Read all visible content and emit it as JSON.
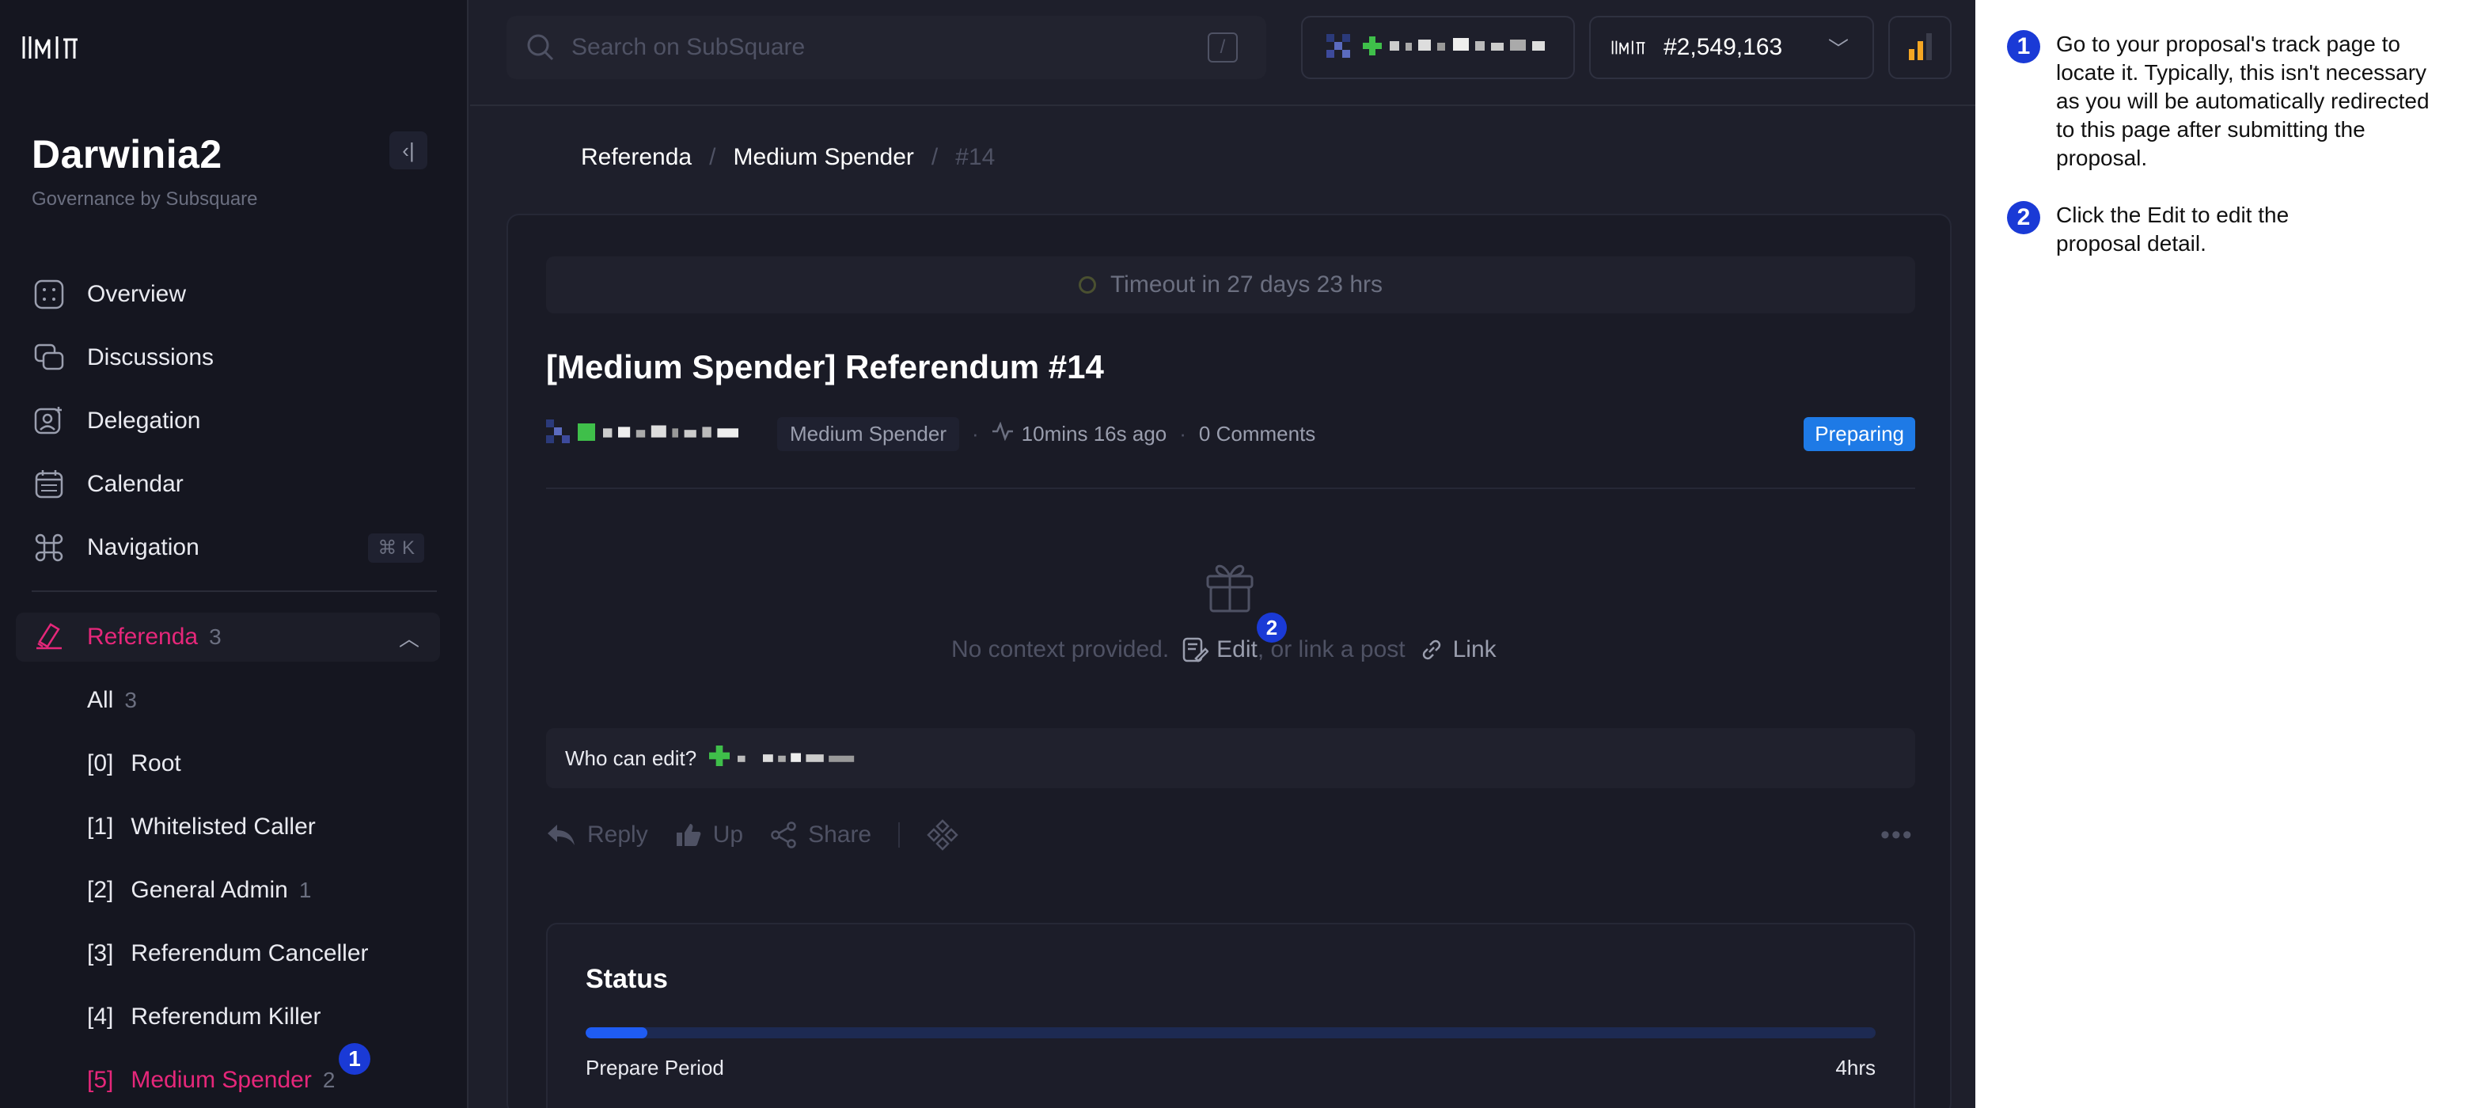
{
  "app": {
    "name": "Darwinia2",
    "subtitle": "Governance by Subsquare"
  },
  "sidebar": {
    "items": [
      {
        "label": "Overview",
        "icon": "overview-icon"
      },
      {
        "label": "Discussions",
        "icon": "discussions-icon"
      },
      {
        "label": "Delegation",
        "icon": "delegation-icon"
      },
      {
        "label": "Calendar",
        "icon": "calendar-icon"
      },
      {
        "label": "Navigation",
        "icon": "command-icon",
        "shortcut": "⌘ K"
      }
    ],
    "referenda": {
      "label": "Referenda",
      "count": "3",
      "tracks": [
        {
          "num": "All",
          "label": "",
          "count": "3"
        },
        {
          "num": "[0]",
          "label": "Root",
          "count": ""
        },
        {
          "num": "[1]",
          "label": "Whitelisted Caller",
          "count": ""
        },
        {
          "num": "[2]",
          "label": "General Admin",
          "count": "1"
        },
        {
          "num": "[3]",
          "label": "Referendum Canceller",
          "count": ""
        },
        {
          "num": "[4]",
          "label": "Referendum Killer",
          "count": ""
        },
        {
          "num": "[5]",
          "label": "Medium Spender",
          "count": "2"
        }
      ]
    }
  },
  "topbar": {
    "search_placeholder": "Search on SubSquare",
    "search_shortcut": "/",
    "block_number": "#2,549,163"
  },
  "breadcrumb": {
    "items": [
      "Referenda",
      "Medium Spender"
    ],
    "current": "#14"
  },
  "post": {
    "timeout": "Timeout in 27 days 23 hrs",
    "title": "[Medium Spender] Referendum #14",
    "track_tag": "Medium Spender",
    "time_ago": "10mins 16s ago",
    "comments": "0 Comments",
    "status": "Preparing",
    "empty_text": "No context provided.",
    "edit_label": "Edit",
    "or_link_text": ", or link a post",
    "link_label": "Link",
    "who_can_edit": "Who can edit?"
  },
  "actions": {
    "reply": "Reply",
    "up": "Up",
    "share": "Share"
  },
  "status_panel": {
    "title": "Status",
    "period_label": "Prepare Period",
    "period_value": "4hrs",
    "progress_fraction": 0.048
  },
  "guide": {
    "steps": [
      {
        "num": "1",
        "text": "Go to your proposal's track page to locate it. Typically, this isn't necessary as you will be automatically redirected to this page after submitting the proposal."
      },
      {
        "num": "2",
        "text": "Click the Edit to edit the proposal detail."
      }
    ]
  },
  "colors": {
    "accent_pink": "#e6277a",
    "status_blue": "#1e7ae6",
    "step_badge": "#1a3ad6",
    "progress": "#1f5cf2"
  }
}
